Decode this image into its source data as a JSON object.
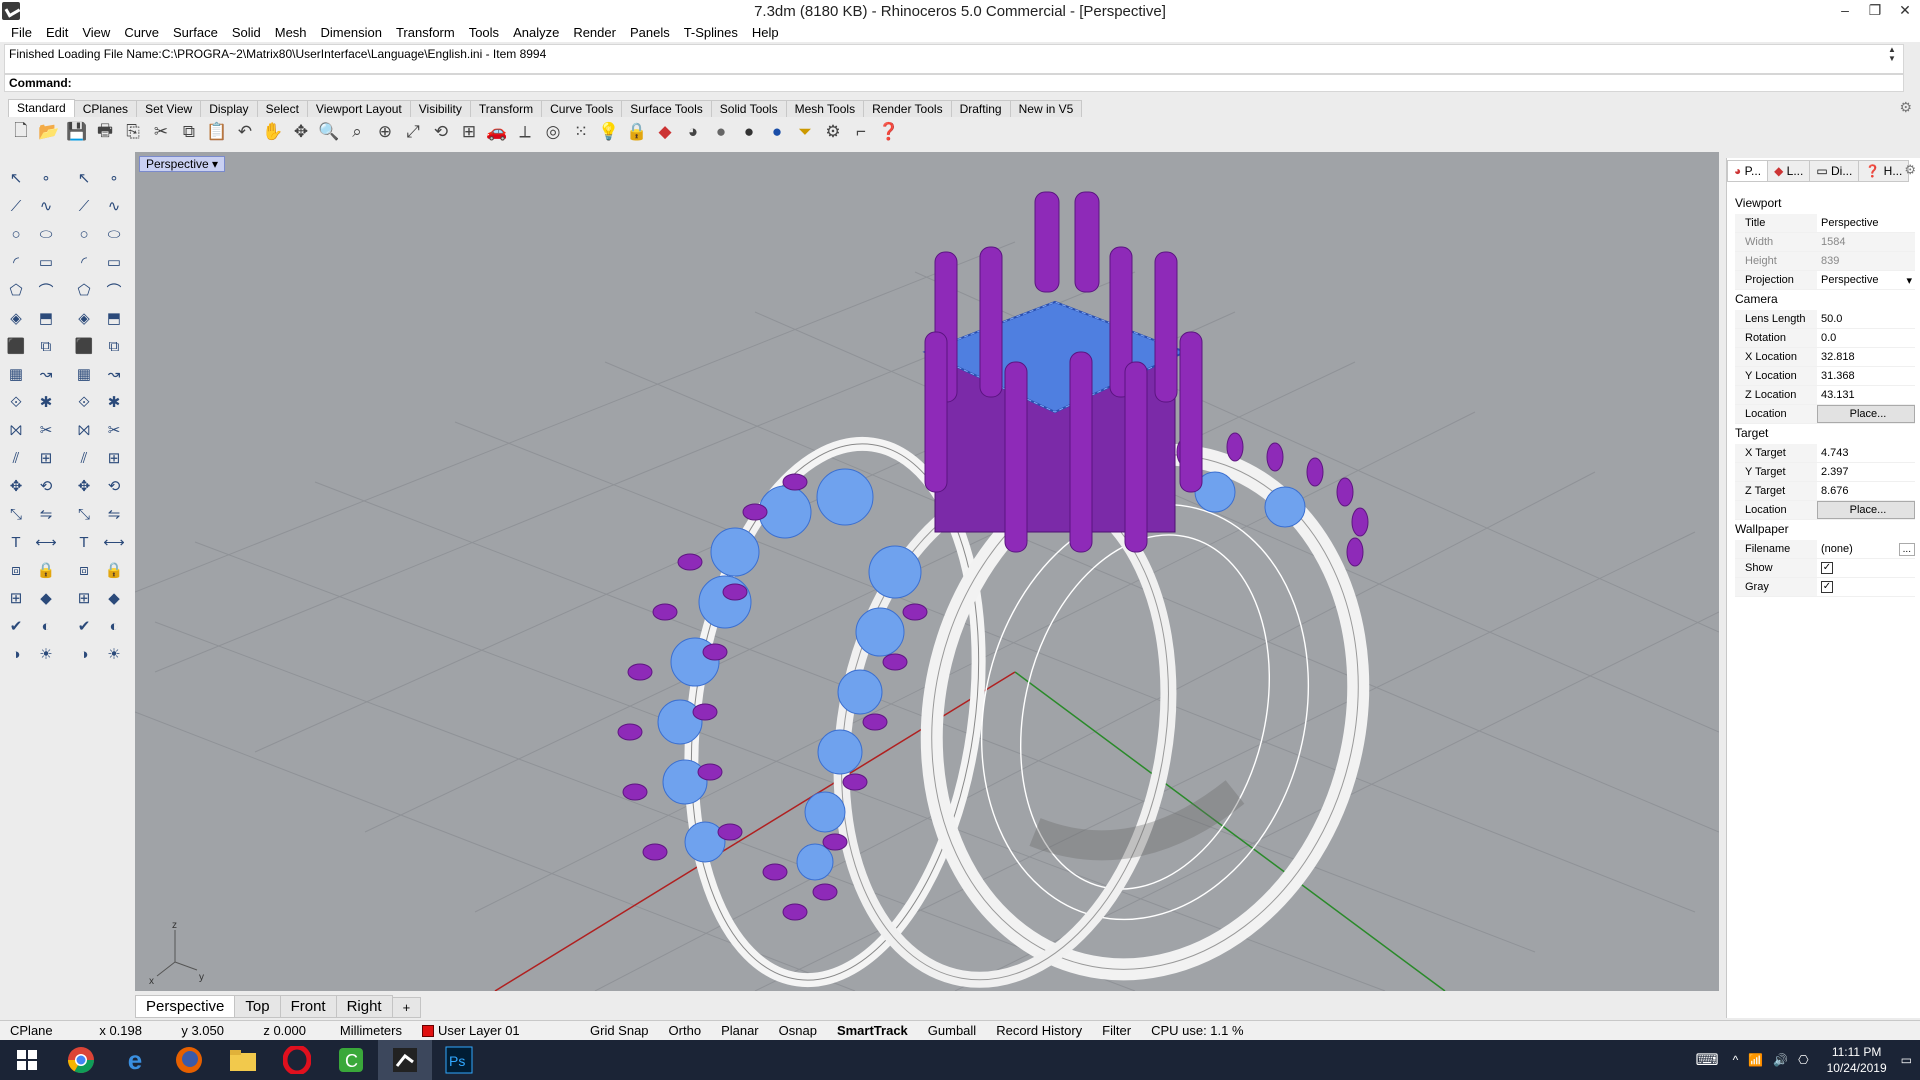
{
  "window": {
    "title": "7.3dm (8180 KB) - Rhinoceros 5.0 Commercial - [Perspective]",
    "controls": [
      "–",
      "❐",
      "✕"
    ]
  },
  "menu": [
    "File",
    "Edit",
    "View",
    "Curve",
    "Surface",
    "Solid",
    "Mesh",
    "Dimension",
    "Transform",
    "Tools",
    "Analyze",
    "Render",
    "Panels",
    "T-Splines",
    "Help"
  ],
  "command": {
    "history": "Finished Loading File Name:C:\\PROGRA~2\\Matrix80\\UserInterface\\Language\\English.ini - Item 8994",
    "prompt": "Command:",
    "value": ""
  },
  "toolbar_tabs": [
    "Standard",
    "CPlanes",
    "Set View",
    "Display",
    "Select",
    "Viewport Layout",
    "Visibility",
    "Transform",
    "Curve Tools",
    "Surface Tools",
    "Solid Tools",
    "Mesh Tools",
    "Render Tools",
    "Drafting",
    "New in V5"
  ],
  "toolbar_icons": [
    "new-icon",
    "open-icon",
    "save-icon",
    "print-icon",
    "import-icon",
    "cut-icon",
    "copy-icon",
    "paste-icon",
    "undo-icon",
    "pan-icon",
    "rotate-view-icon",
    "zoom-icon",
    "zoom-window-icon",
    "zoom-selected-icon",
    "zoom-extents-icon",
    "four-view-icon",
    "car-icon",
    "cplane-icon",
    "circle-icon",
    "points-icon",
    "light-icon",
    "lock-icon",
    "layer-icon",
    "color-wheel-icon",
    "shaded-icon",
    "rendered-icon",
    "material-icon",
    "filter-icon",
    "gear-icon",
    "dimension-icon",
    "help-icon"
  ],
  "viewport": {
    "label": "Perspective",
    "tabs": [
      "Perspective",
      "Top",
      "Front",
      "Right"
    ],
    "add_tab": "+",
    "axis_labels": [
      "z",
      "x",
      "y"
    ]
  },
  "panel": {
    "tabs": [
      "P...",
      "L...",
      "Di...",
      "H..."
    ],
    "sections": {
      "viewport": "Viewport",
      "camera": "Camera",
      "target": "Target",
      "wallpaper": "Wallpaper"
    },
    "viewport_props": [
      {
        "key": "Title",
        "value": "Perspective"
      },
      {
        "key": "Width",
        "value": "1584"
      },
      {
        "key": "Height",
        "value": "839"
      },
      {
        "key": "Projection",
        "value": "Perspective"
      }
    ],
    "camera_props": [
      {
        "key": "Lens Length",
        "value": "50.0"
      },
      {
        "key": "Rotation",
        "value": "0.0"
      },
      {
        "key": "X Location",
        "value": "32.818"
      },
      {
        "key": "Y Location",
        "value": "31.368"
      },
      {
        "key": "Z Location",
        "value": "43.131"
      },
      {
        "key": "Location",
        "value": "Place..."
      }
    ],
    "target_props": [
      {
        "key": "X Target",
        "value": "4.743"
      },
      {
        "key": "Y Target",
        "value": "2.397"
      },
      {
        "key": "Z Target",
        "value": "8.676"
      },
      {
        "key": "Location",
        "value": "Place..."
      }
    ],
    "wallpaper_props": [
      {
        "key": "Filename",
        "value": "(none)"
      },
      {
        "key": "Show",
        "value": "✓"
      },
      {
        "key": "Gray",
        "value": "✓"
      }
    ]
  },
  "status": {
    "cplane": "CPlane",
    "x": "x 0.198",
    "y": "y 3.050",
    "z": "z 0.000",
    "units": "Millimeters",
    "layer": "User Layer 01",
    "layer_color": "#e01010",
    "toggles": [
      "Grid Snap",
      "Ortho",
      "Planar",
      "Osnap",
      "SmartTrack",
      "Gumball",
      "Record History",
      "Filter"
    ],
    "cpu": "CPU use: 1.1 %"
  },
  "taskbar": {
    "apps": [
      "windows-start-icon",
      "chrome-icon",
      "ie-icon",
      "firefox-icon",
      "explorer-icon",
      "opera-icon",
      "camtasia-icon",
      "rhino-icon",
      "photoshop-icon"
    ],
    "time": "11:11 PM",
    "date": "10/24/2019"
  },
  "colors": {
    "viewport_bg": "#a0a3a7",
    "prongs": "#8e2ab8",
    "gems": "#6fa2ee",
    "ring_wire": "#ffffff",
    "taskbar": "#1b2436"
  }
}
